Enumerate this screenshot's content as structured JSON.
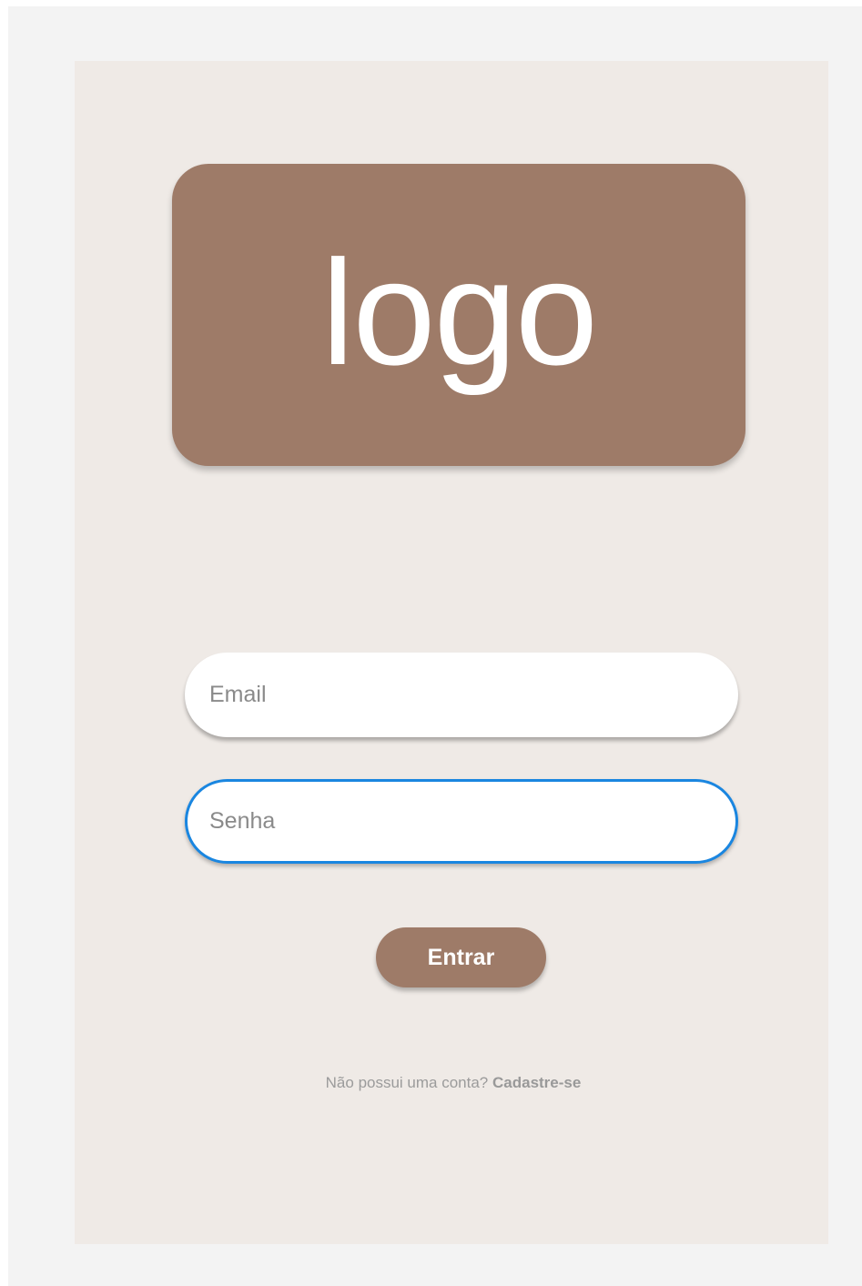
{
  "logo": {
    "text": "logo"
  },
  "form": {
    "email_placeholder": "Email",
    "password_placeholder": "Senha",
    "submit_label": "Entrar"
  },
  "signup": {
    "prompt": "Não possui uma conta?",
    "link_label": "Cadastre-se"
  },
  "colors": {
    "brand": "#9e7b68",
    "background": "#efeae6",
    "focus_border": "#1a86e0"
  }
}
